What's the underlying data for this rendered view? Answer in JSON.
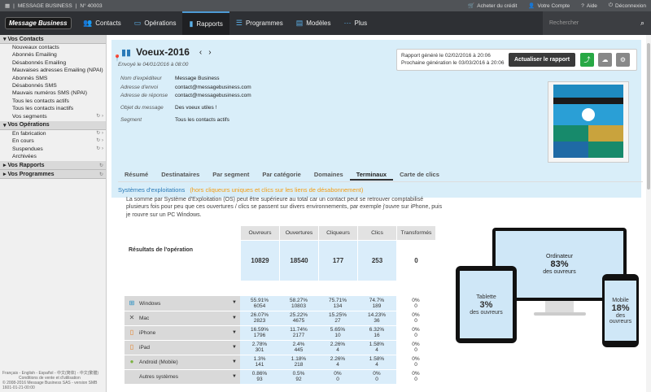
{
  "topbar": {
    "company": "MESSAGE BUSINESS",
    "account_no": "N° 40003",
    "buy_credit": "Acheter du crédit",
    "my_account": "Votre Compte",
    "help": "Aide",
    "logout": "Déconnexion"
  },
  "nav": {
    "logo": "Message Business",
    "items": [
      "Contacts",
      "Opérations",
      "Rapports",
      "Programmes",
      "Modèles",
      "Plus"
    ],
    "search_placeholder": "Rechercher"
  },
  "sidebar": {
    "contacts_title": "Vos Contacts",
    "contacts_items": [
      "Nouveaux contacts",
      "Abonnés Emailing",
      "Désabonnés Emailing",
      "Mauvaises adresses Emailing (NPAI)",
      "Abonnés SMS",
      "Désabonnés SMS",
      "Mauvais numéros SMS (NPAI)",
      "Tous les contacts actifs",
      "Tous les contacts inactifs",
      "Vos segments"
    ],
    "operations_title": "Vos Opérations",
    "operations_items": [
      "En fabrication",
      "En cours",
      "Suspendues",
      "Archivées"
    ],
    "reports_title": "Vos Rapports",
    "programs_title": "Vos Programmes",
    "footer_lang": "Français - English - Español - 中文(简体) - 中文(繁體)",
    "footer_terms": "Conditions de vente et d'utilisation",
    "footer_copy": "© 2008-2016 Message Business SAS - version SMB 1601-01-21-00:00"
  },
  "operation": {
    "title": "Voeux-2016",
    "sent": "Envoyé le 04/01/2016 à 08:00",
    "meta": [
      {
        "k": "Nom d'expéditeur",
        "v": "Message Business"
      },
      {
        "k": "Adresse d'envoi",
        "v": "contact@messagebusiness.com"
      },
      {
        "k": "Adresse de réponse",
        "v": "contact@messagebusiness.com"
      },
      {
        "k": "Objet du message",
        "v": "Des voeux utiles !"
      },
      {
        "k": "Segment",
        "v": "Tous les contacts actifs"
      }
    ]
  },
  "report": {
    "generated": "Rapport généré le 02/02/2016 à 20:06",
    "next": "Prochaine génération le 03/03/2016 à 20:06",
    "refresh_label": "Actualiser le rapport",
    "share_color": "#27a844"
  },
  "tabs": [
    "Résumé",
    "Destinataires",
    "Par segment",
    "Par catégorie",
    "Domaines",
    "Terminaux",
    "Carte de clics"
  ],
  "section": {
    "title": "Systèmes d'exploitations",
    "subtitle": "(hors cliqueurs uniques et clics sur les liens de désabonnement)",
    "description": "La somme par Système d'Exploitation (OS) peut être supérieure au total car un contact peut se retrouver comptabilisé plusieurs fois pour peu que ces ouvertures / clics se passent sur divers environnements, par exemple j'ouvre sur iPhone, puis je rouvre sur un PC Windows."
  },
  "results": {
    "label": "Résultats de l'opération",
    "headers": [
      "Ouvreurs",
      "Ouvertures",
      "Cliqueurs",
      "Clics",
      "Transformés"
    ],
    "values": [
      "10829",
      "18540",
      "177",
      "253",
      "0"
    ]
  },
  "os_rows": [
    {
      "name": "Windows",
      "icon": "windows-icon",
      "cells": [
        [
          "55.91%",
          "6054"
        ],
        [
          "58.27%",
          "10803"
        ],
        [
          "75.71%",
          "134"
        ],
        [
          "74.7%",
          "189"
        ],
        [
          "0%",
          "0"
        ]
      ]
    },
    {
      "name": "Mac",
      "icon": "apple-icon",
      "cells": [
        [
          "26.07%",
          "2823"
        ],
        [
          "25.22%",
          "4675"
        ],
        [
          "15.25%",
          "27"
        ],
        [
          "14.23%",
          "36"
        ],
        [
          "0%",
          "0"
        ]
      ]
    },
    {
      "name": "iPhone",
      "icon": "iphone-icon",
      "cells": [
        [
          "16.59%",
          "1796"
        ],
        [
          "11.74%",
          "2177"
        ],
        [
          "5.65%",
          "10"
        ],
        [
          "6.32%",
          "16"
        ],
        [
          "0%",
          "0"
        ]
      ]
    },
    {
      "name": "iPad",
      "icon": "ipad-icon",
      "cells": [
        [
          "2.78%",
          "301"
        ],
        [
          "2.4%",
          "445"
        ],
        [
          "2.26%",
          "4"
        ],
        [
          "1.58%",
          "4"
        ],
        [
          "0%",
          "0"
        ]
      ]
    },
    {
      "name": "Android (Mobile)",
      "icon": "android-icon",
      "cells": [
        [
          "1.3%",
          "141"
        ],
        [
          "1.18%",
          "218"
        ],
        [
          "2.26%",
          "4"
        ],
        [
          "1.58%",
          "4"
        ],
        [
          "0%",
          "0"
        ]
      ]
    },
    {
      "name": "Autres systèmes",
      "icon": "",
      "cells": [
        [
          "0.86%",
          "93"
        ],
        [
          "0.5%",
          "92"
        ],
        [
          "0%",
          "0"
        ],
        [
          "0%",
          "0"
        ],
        [
          "0%",
          "0"
        ]
      ]
    }
  ],
  "devices": {
    "desktop": {
      "label": "Ordinateur",
      "pct": "83%",
      "sub": "des ouvreurs"
    },
    "tablet": {
      "label": "Tablette",
      "pct": "3%",
      "sub": "des ouvreurs"
    },
    "mobile": {
      "label": "Mobile",
      "pct": "18%",
      "sub": "des ouvreurs"
    }
  },
  "colors": {
    "accent": "#2a7ab8",
    "orange": "#f39c12",
    "hero_bg": "#d9eef9",
    "nav_bg": "#2e3034"
  }
}
